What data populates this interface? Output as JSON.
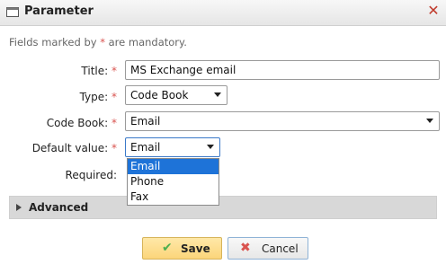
{
  "dialog": {
    "title": "Parameter"
  },
  "note": {
    "prefix": "Fields marked by ",
    "star": "*",
    "suffix": " are mandatory."
  },
  "form": {
    "title": {
      "label": "Title:",
      "value": "MS Exchange email"
    },
    "type": {
      "label": "Type:",
      "value": "Code Book"
    },
    "code_book": {
      "label": "Code Book:",
      "value": "Email"
    },
    "default_value": {
      "label": "Default value:",
      "value": "Email",
      "options": [
        "Email",
        "Phone",
        "Fax"
      ]
    },
    "required": {
      "label": "Required:"
    },
    "star": "*"
  },
  "sections": {
    "advanced": "Advanced"
  },
  "buttons": {
    "save": "Save",
    "cancel": "Cancel"
  },
  "colors": {
    "accent": "#1e73d8",
    "required_star": "#d9534f",
    "save_bg": "#fbd57a"
  }
}
